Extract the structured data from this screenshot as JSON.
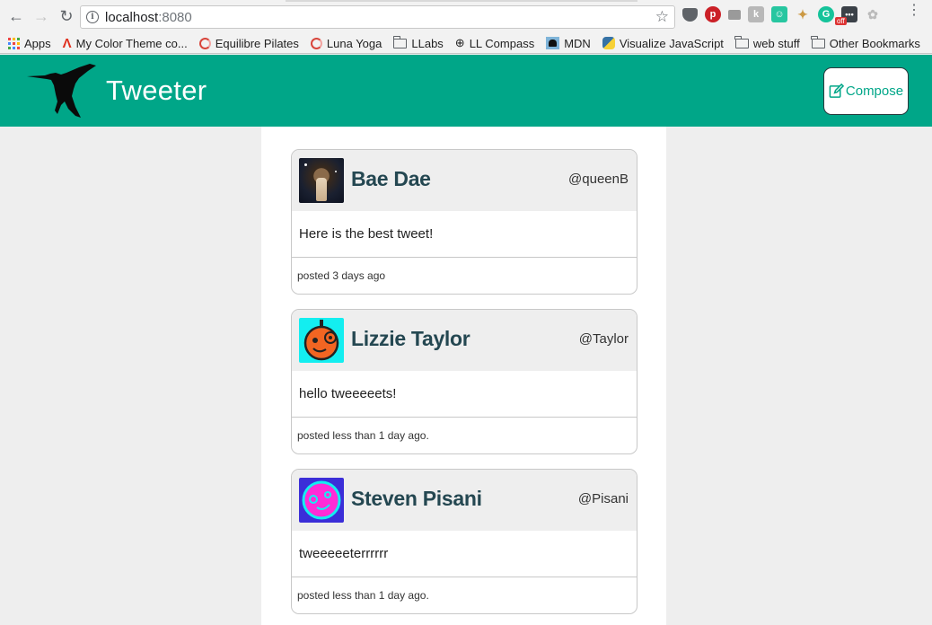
{
  "browser": {
    "url_host": "localhost",
    "url_port": ":8080",
    "extension_badge": "off"
  },
  "bookmarks": [
    {
      "label": "Apps",
      "icon": "apps-grid-icon"
    },
    {
      "label": "My Color Theme co...",
      "icon": "adobe-icon"
    },
    {
      "label": "Equilibre Pilates",
      "icon": "ring-icon"
    },
    {
      "label": "Luna Yoga",
      "icon": "ring-icon"
    },
    {
      "label": "LLabs",
      "icon": "folder-icon"
    },
    {
      "label": "LL Compass",
      "icon": "compass-icon"
    },
    {
      "label": "MDN",
      "icon": "mdn-icon"
    },
    {
      "label": "Visualize JavaScript",
      "icon": "python-icon"
    },
    {
      "label": "web stuff",
      "icon": "folder-icon"
    },
    {
      "label": "Other Bookmarks",
      "icon": "folder-icon"
    }
  ],
  "app": {
    "title": "Tweeter",
    "compose_label": "Compose",
    "brand_color": "#00a688",
    "name_color": "#244751"
  },
  "tweets": [
    {
      "name": "Bae Dae",
      "handle": "@queenB",
      "body": "Here is the best tweet!",
      "posted": "posted 3 days ago",
      "avatar": "photo-avatar"
    },
    {
      "name": "Lizzie Taylor",
      "handle": "@Taylor",
      "body": "hello tweeeeets!",
      "posted": "posted less than 1 day ago.",
      "avatar": "orange-robot-avatar"
    },
    {
      "name": "Steven Pisani",
      "handle": "@Pisani",
      "body": "tweeeeeterrrrrr",
      "posted": "posted less than 1 day ago.",
      "avatar": "pink-face-avatar"
    }
  ]
}
